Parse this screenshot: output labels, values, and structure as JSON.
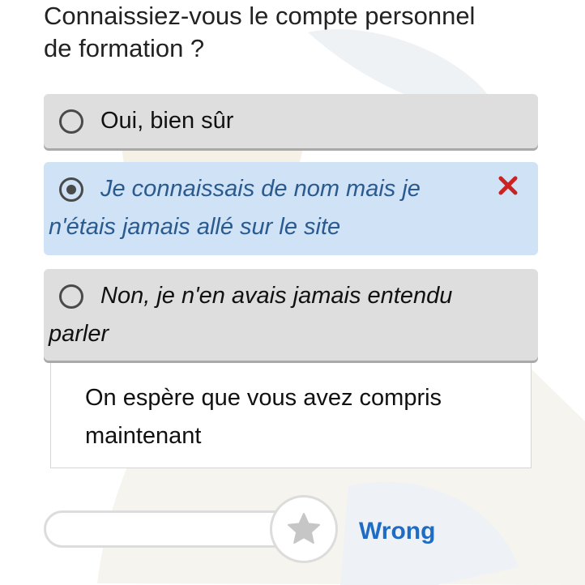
{
  "question": "Connaissiez-vous le compte personnel de formation ?",
  "options": [
    {
      "label": "Oui, bien sûr",
      "selected": false
    },
    {
      "label": "Je connaissais de nom mais je n'étais jamais allé sur le site",
      "selected": true,
      "status_icon": "close-icon"
    },
    {
      "label": "Non, je n'en avais jamais entendu parler",
      "selected": false
    }
  ],
  "feedback": "On espère que vous avez compris maintenant",
  "score": {
    "icon": "star-icon",
    "fill_fraction": 0
  },
  "result_label": "Wrong",
  "colors": {
    "option_bg": "#dedede",
    "option_selected_bg": "#cfe2f6",
    "selected_text": "#2a5a8e",
    "wrong_mark": "#cc2222",
    "result_text": "#1f6cc4"
  }
}
